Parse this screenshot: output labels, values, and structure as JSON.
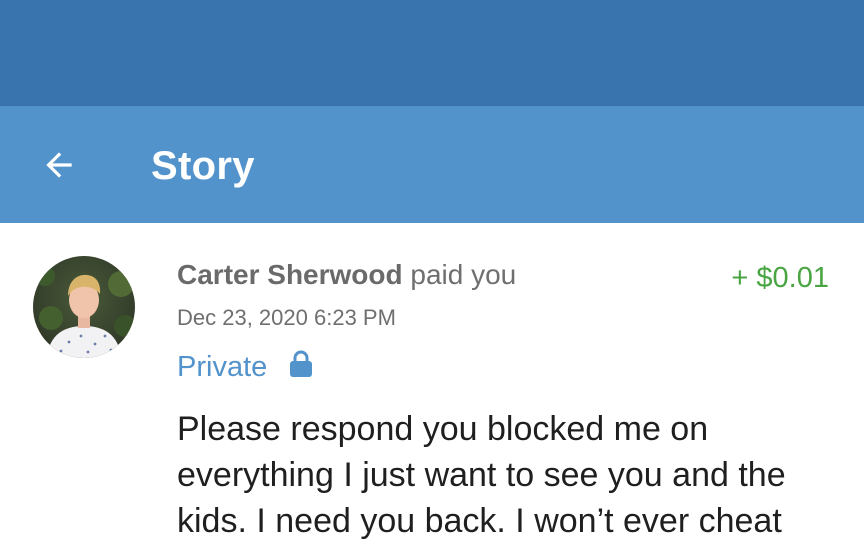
{
  "app_bar": {
    "title": "Story",
    "back_icon": "arrow-left-icon"
  },
  "colors": {
    "status_bar": "#3a74ae",
    "app_bar": "#5393cc",
    "amount_positive": "#48a541",
    "privacy_accent": "#5393cc"
  },
  "story": {
    "sender_name": "Carter Sherwood",
    "action_text": " paid you",
    "amount": "+ $0.01",
    "timestamp": "Dec 23, 2020 6:23 PM",
    "privacy_label": "Private",
    "privacy_icon": "lock-icon",
    "message": "Please respond you blocked me on everything I just want to see you and the kids. I need you back. I won’t ever cheat"
  }
}
